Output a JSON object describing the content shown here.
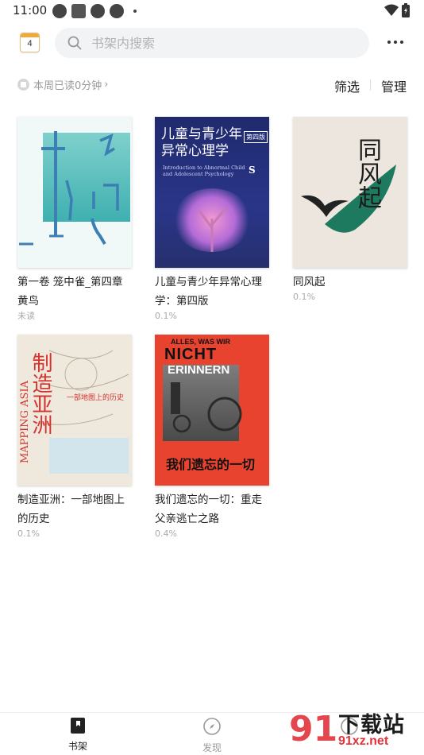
{
  "status_bar": {
    "time": "11:00"
  },
  "header": {
    "calendar_day": "4",
    "search_placeholder": "书架内搜索"
  },
  "toolbar": {
    "reading_summary": "本周已读0分钟",
    "filter_label": "筛选",
    "manage_label": "管理"
  },
  "books": [
    {
      "title": "第一卷 笼中雀_第四章 黄鸟",
      "progress": "未读"
    },
    {
      "title": "儿童与青少年异常心理学：第四版",
      "progress": "0.1%",
      "cover_title": "儿童与青少年异常心理学",
      "cover_badge": "第四版",
      "cover_en": "Introduction to Abnormal Child and Adolescent Psychology"
    },
    {
      "title": "同风起",
      "progress": "0.1%",
      "cover_title": "同风起"
    },
    {
      "title": "制造亚洲：一部地图上的历史",
      "progress": "0.1%",
      "cover_title": "制造亚洲",
      "cover_sub": "一部地图上的历史",
      "cover_en": "MAPPING ASIA"
    },
    {
      "title": "我们遗忘的一切：重走父亲逃亡之路",
      "progress": "0.4%",
      "cover_title": "我们遗忘的一切",
      "cover_de1": "ALLES, WAS WIR",
      "cover_de2": "NICHT",
      "cover_de3": "ERINNERN"
    }
  ],
  "bottom_nav": {
    "shelf_label": "书架",
    "discover_label": "发现"
  },
  "watermark": {
    "mark": "91",
    "name": "下载站",
    "url": "91xz.net"
  },
  "colors": {
    "accent": "#e0323a",
    "text": "#222222",
    "muted": "#999999"
  }
}
